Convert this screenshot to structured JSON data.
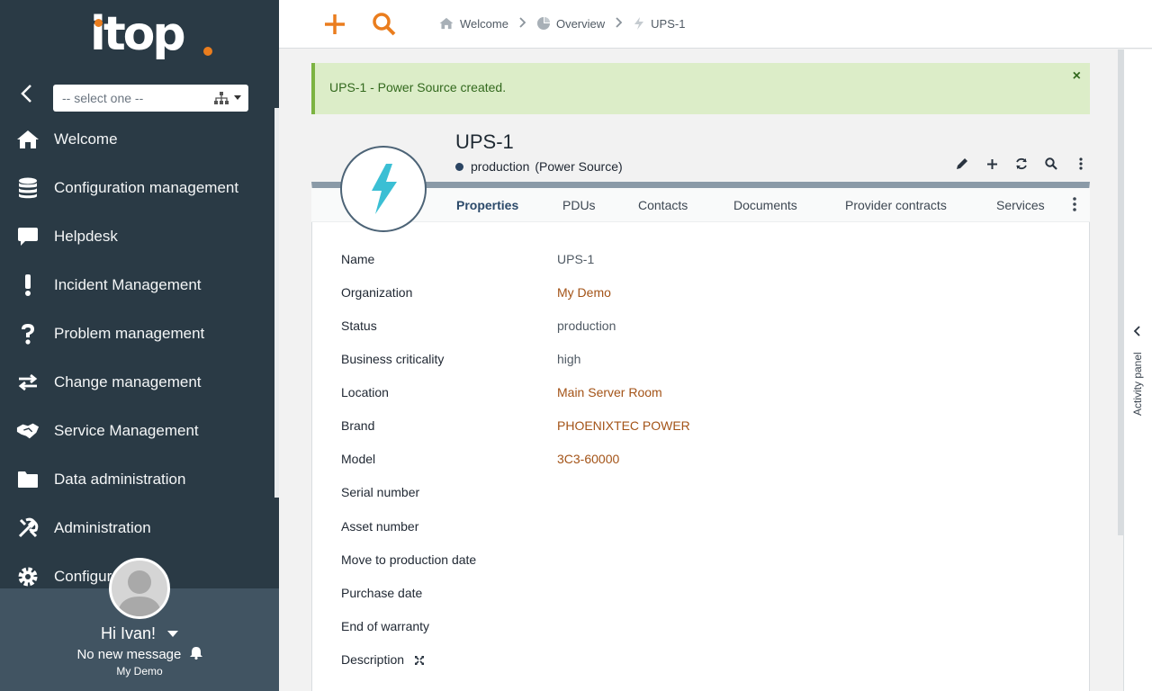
{
  "app": {
    "logo_text": "itop"
  },
  "sidebar": {
    "org_select_placeholder": "-- select one --",
    "items": [
      {
        "label": "Welcome",
        "icon": "home-icon"
      },
      {
        "label": "Configuration management",
        "icon": "database-icon"
      },
      {
        "label": "Helpdesk",
        "icon": "comment-icon"
      },
      {
        "label": "Incident Management",
        "icon": "exclamation-icon"
      },
      {
        "label": "Problem management",
        "icon": "question-icon"
      },
      {
        "label": "Change management",
        "icon": "exchange-icon"
      },
      {
        "label": "Service Management",
        "icon": "handshake-icon"
      },
      {
        "label": "Data administration",
        "icon": "folder-icon"
      },
      {
        "label": "Administration",
        "icon": "tools-icon"
      },
      {
        "label": "Configur",
        "icon": "cog-icon"
      }
    ],
    "user": {
      "greeting": "Hi Ivan!",
      "messages": "No new message",
      "organization": "My Demo"
    }
  },
  "topbar": {
    "breadcrumb": [
      {
        "label": "Welcome",
        "icon": "home-icon"
      },
      {
        "label": "Overview",
        "icon": "pie-chart-icon"
      },
      {
        "label": "UPS-1",
        "icon": "bolt-icon"
      }
    ]
  },
  "alert": {
    "message": "UPS-1 - Power Source created.",
    "close": "×"
  },
  "object": {
    "name": "UPS-1",
    "status": "production",
    "class": "(Power Source)",
    "tabs": [
      "Properties",
      "PDUs",
      "Contacts",
      "Documents",
      "Provider contracts",
      "Services"
    ],
    "active_tab": "Properties",
    "fields": [
      {
        "label": "Name",
        "value": "UPS-1",
        "link": false
      },
      {
        "label": "Organization",
        "value": "My Demo",
        "link": true
      },
      {
        "label": "Status",
        "value": "production",
        "link": false
      },
      {
        "label": "Business criticality",
        "value": "high",
        "link": false
      },
      {
        "label": "Location",
        "value": "Main Server Room",
        "link": true
      },
      {
        "label": "Brand",
        "value": "PHOENIXTEC POWER",
        "link": true
      },
      {
        "label": "Model",
        "value": "3C3-60000",
        "link": true
      },
      {
        "label": "Serial number",
        "value": "",
        "link": false
      },
      {
        "label": "Asset number",
        "value": "",
        "link": false
      },
      {
        "label": "Move to production date",
        "value": "",
        "link": false
      },
      {
        "label": "Purchase date",
        "value": "",
        "link": false
      },
      {
        "label": "End of warranty",
        "value": "",
        "link": false
      },
      {
        "label": "Description",
        "value": "",
        "link": false
      }
    ]
  },
  "activity_panel": {
    "label": "Activity panel"
  },
  "colors": {
    "sidebar": "#2a3a45",
    "accent": "#ea7d1e",
    "link": "#a35317",
    "alert_bg": "#dcedc8",
    "bolt": "#3bbfd4"
  }
}
